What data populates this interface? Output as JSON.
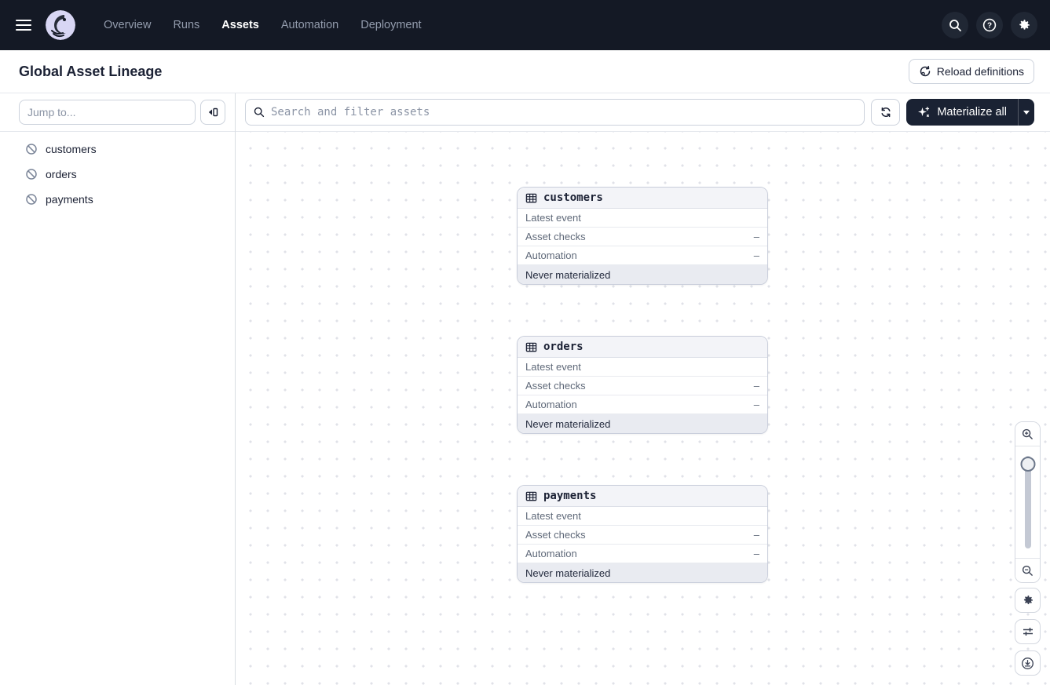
{
  "topnav": {
    "items": [
      {
        "label": "Overview",
        "active": false
      },
      {
        "label": "Runs",
        "active": false
      },
      {
        "label": "Assets",
        "active": true
      },
      {
        "label": "Automation",
        "active": false
      },
      {
        "label": "Deployment",
        "active": false
      }
    ]
  },
  "page_header": {
    "title": "Global Asset Lineage",
    "reload_button_label": "Reload definitions"
  },
  "sidebar": {
    "jump_placeholder": "Jump to...",
    "assets": [
      {
        "name": "customers"
      },
      {
        "name": "orders"
      },
      {
        "name": "payments"
      }
    ]
  },
  "toolbar": {
    "search_placeholder": "Search and filter assets",
    "materialize_button_label": "Materialize all"
  },
  "graph": {
    "nodes": [
      {
        "name": "customers",
        "rows": [
          {
            "label": "Latest event",
            "value": ""
          },
          {
            "label": "Asset checks",
            "value": "–"
          },
          {
            "label": "Automation",
            "value": "–"
          }
        ],
        "footer": "Never materialized"
      },
      {
        "name": "orders",
        "rows": [
          {
            "label": "Latest event",
            "value": ""
          },
          {
            "label": "Asset checks",
            "value": "–"
          },
          {
            "label": "Automation",
            "value": "–"
          }
        ],
        "footer": "Never materialized"
      },
      {
        "name": "payments",
        "rows": [
          {
            "label": "Latest event",
            "value": ""
          },
          {
            "label": "Asset checks",
            "value": "–"
          },
          {
            "label": "Automation",
            "value": "–"
          }
        ],
        "footer": "Never materialized"
      }
    ]
  },
  "colors": {
    "navbar_bg": "#141925",
    "accent_dark_button": "#1a2233",
    "logo_lavender": "#d8d6f4",
    "canvas_dot": "#e0e2e8",
    "node_header_bg": "#f3f4f8",
    "node_footer_bg": "#e9ebf1"
  }
}
